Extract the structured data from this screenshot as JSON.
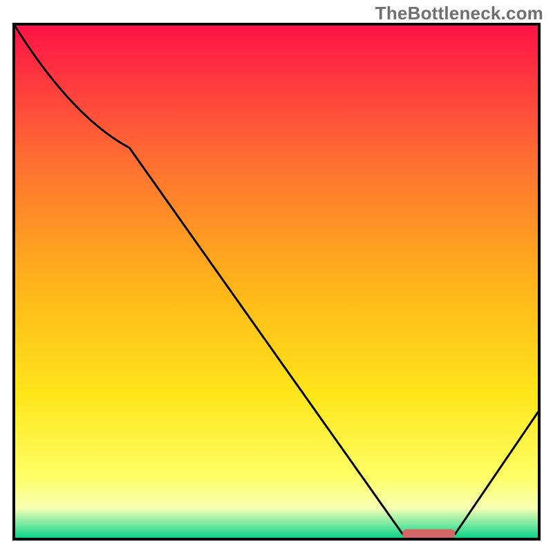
{
  "watermark": "TheBottleneck.com",
  "colors": {
    "border": "#000000",
    "line": "#000000",
    "marker": "#d66666",
    "gradient_stops": [
      {
        "offset": 0.0,
        "color": "#ff1247"
      },
      {
        "offset": 0.25,
        "color": "#ff6a33"
      },
      {
        "offset": 0.5,
        "color": "#ffb31a"
      },
      {
        "offset": 0.72,
        "color": "#ffe61a"
      },
      {
        "offset": 0.88,
        "color": "#ffff66"
      },
      {
        "offset": 0.94,
        "color": "#f6ffb3"
      },
      {
        "offset": 0.975,
        "color": "#66e69e"
      },
      {
        "offset": 1.0,
        "color": "#00d184"
      }
    ]
  },
  "chart_data": {
    "type": "line",
    "title": "",
    "xlabel": "",
    "ylabel": "",
    "xlim": [
      0,
      100
    ],
    "ylim": [
      0,
      100
    ],
    "grid": false,
    "legend": false,
    "annotations": [
      "TheBottleneck.com"
    ],
    "series": [
      {
        "name": "curve",
        "x": [
          0,
          22,
          74,
          80,
          84,
          100
        ],
        "y": [
          100,
          76,
          1,
          1,
          1,
          25
        ]
      }
    ],
    "marker": {
      "x_start": 74,
      "x_end": 84,
      "y": 1
    }
  }
}
